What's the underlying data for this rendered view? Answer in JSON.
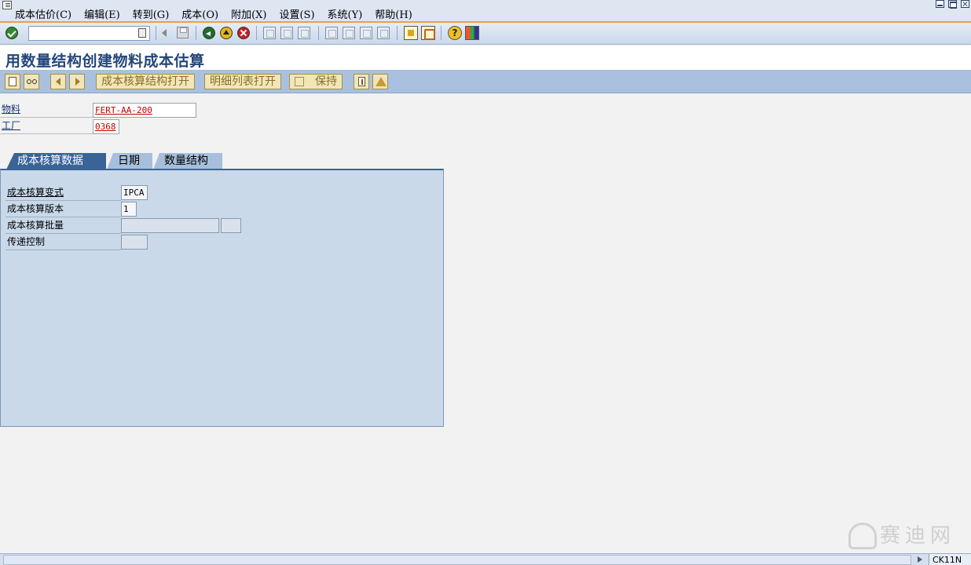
{
  "menu": {
    "items": [
      {
        "label": "成本估价(C)"
      },
      {
        "label": "编辑(E)"
      },
      {
        "label": "转到(G)"
      },
      {
        "label": "成本(O)"
      },
      {
        "label": "附加(X)"
      },
      {
        "label": "设置(S)"
      },
      {
        "label": "系统(Y)"
      },
      {
        "label": "帮助(H)"
      }
    ]
  },
  "toolbar": {
    "command_value": "",
    "icons": [
      "enter-icon",
      "save-icon",
      "back-icon",
      "exit-icon",
      "cancel-icon",
      "print-icon",
      "find-icon",
      "find-next-icon",
      "first-page-icon",
      "previous-page-icon",
      "next-page-icon",
      "last-page-icon",
      "create-session-icon",
      "create-shortcut-icon",
      "help-icon",
      "customize-layout-icon"
    ]
  },
  "title": "用数量结构创建物料成本估算",
  "app_toolbar": {
    "buttons": [
      {
        "label": "成本核算结构打开"
      },
      {
        "label": "明细列表打开"
      },
      {
        "label": "保持"
      }
    ]
  },
  "header": {
    "material_label": "物料",
    "material_value": "FERT-AA-200",
    "plant_label": "工厂",
    "plant_value": "0368"
  },
  "tabs": [
    {
      "label": "成本核算数据",
      "active": true
    },
    {
      "label": "日期",
      "active": false
    },
    {
      "label": "数量结构",
      "active": false
    }
  ],
  "costing_data": {
    "variant_label": "成本核算变式",
    "variant_value": "IPCA",
    "version_label": "成本核算版本",
    "version_value": "1",
    "lot_label": "成本核算批量",
    "lot_value": "",
    "lot_unit": "",
    "transfer_label": "传递控制",
    "transfer_value": ""
  },
  "status": {
    "message": "",
    "tcode": "CK11N"
  },
  "watermark": {
    "text": "赛迪网"
  },
  "colors": {
    "title": "#24467a",
    "menu_underline": "#e8a33d",
    "active_tab": "#3a6496",
    "panel": "#c9d9ea",
    "app_toolbar": "#a9c1de",
    "required_value": "#c20000"
  }
}
